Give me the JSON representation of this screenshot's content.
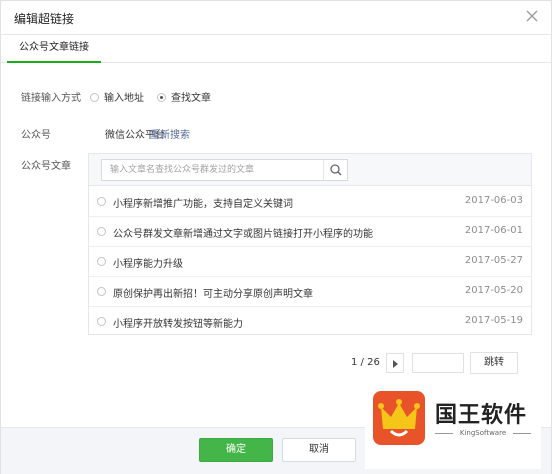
{
  "dialog": {
    "title": "编辑超链接",
    "close_icon": "close-icon"
  },
  "tabs": [
    {
      "label": "公众号文章链接",
      "active": true
    }
  ],
  "link_method": {
    "label": "链接输入方式",
    "options": [
      {
        "label": "输入地址",
        "checked": false
      },
      {
        "label": "查找文章",
        "checked": true
      }
    ]
  },
  "account": {
    "label": "公众号",
    "name": "微信公众平台",
    "research_label": "重新搜索"
  },
  "articles_section": {
    "label": "公众号文章",
    "search": {
      "placeholder": "输入文章名查找公众号群发过的文章",
      "value": "",
      "icon": "search-icon"
    },
    "items": [
      {
        "title": "小程序新增推广功能，支持自定义关键词",
        "date": "2017-06-03"
      },
      {
        "title": "公众号群发文章新增通过文字或图片链接打开小程序的功能",
        "date": "2017-06-01"
      },
      {
        "title": "小程序能力升级",
        "date": "2017-05-27"
      },
      {
        "title": "原创保护再出新招！可主动分享原创声明文章",
        "date": "2017-05-20"
      },
      {
        "title": "小程序开放转发按钮等新能力",
        "date": "2017-05-19"
      }
    ]
  },
  "pagination": {
    "text": "1 / 26",
    "next_icon": "triangle-right-icon",
    "jump_value": "",
    "jump_label": "跳转"
  },
  "footer": {
    "confirm_label": "确定",
    "cancel_label": "取消"
  },
  "watermark": {
    "name": "国王软件",
    "sub": "KingSoftware"
  },
  "colors": {
    "accent": "#44b549",
    "link": "#576b95",
    "watermark_brand": "#e8532a"
  }
}
